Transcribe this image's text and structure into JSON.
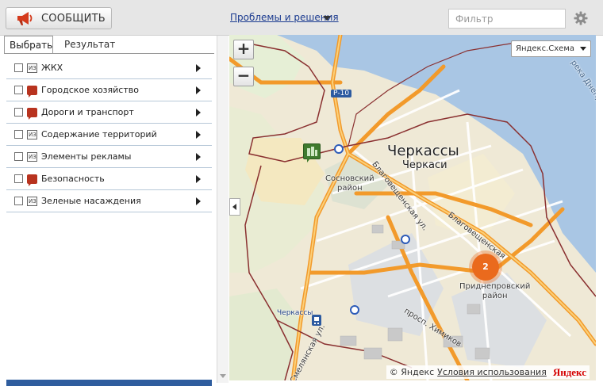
{
  "toolbar": {
    "report_button": "СООБЩИТЬ",
    "problems_link": "Проблемы и решения",
    "filter_placeholder": "Фильтр"
  },
  "tabs": [
    {
      "label": "Выбрать",
      "active": true
    },
    {
      "label": "Результат",
      "active": false
    }
  ],
  "categories": [
    {
      "label": "ЖКХ",
      "icon": "doc-icon"
    },
    {
      "label": "Городское хозяйство",
      "icon": "speech-bubble-icon"
    },
    {
      "label": "Дороги и транспорт",
      "icon": "speech-bubble-icon"
    },
    {
      "label": "Содержание территорий",
      "icon": "doc-icon"
    },
    {
      "label": "Элементы рекламы",
      "icon": "doc-icon"
    },
    {
      "label": "Безопасность",
      "icon": "speech-bubble-icon"
    },
    {
      "label": "Зеленые насаждения",
      "icon": "doc-icon"
    }
  ],
  "category_icon_text": "ИЗ",
  "map": {
    "zoom_in": "+",
    "zoom_out": "−",
    "type_selector": "Яндекс.Схема",
    "labels": {
      "city_ua": "Черкассы",
      "city_ru": "Черкаси",
      "district_sosnovsky": "Сосновский\nрайон",
      "district_pridneprovsky": "Приднепровский\nрайон",
      "street_blagoveshchenskaya_1": "Благовещенская ул.",
      "street_blagoveshchenskaya_2": "Благовещенская",
      "street_khimikov": "просп. Химиков",
      "street_smelyanskaya": "Смелянская ул.",
      "road_badge": "Р-10",
      "river": "река Днепр",
      "station": "Черкассы"
    },
    "cluster_count": "2",
    "copyright": "© Яндекс",
    "terms_link": "Условия использования",
    "brand": "Яндекс",
    "colors": {
      "water": "#a9c6e4",
      "land": "#efe9d6",
      "major_road": "#f29a2b",
      "boundary": "#8a3030"
    }
  }
}
